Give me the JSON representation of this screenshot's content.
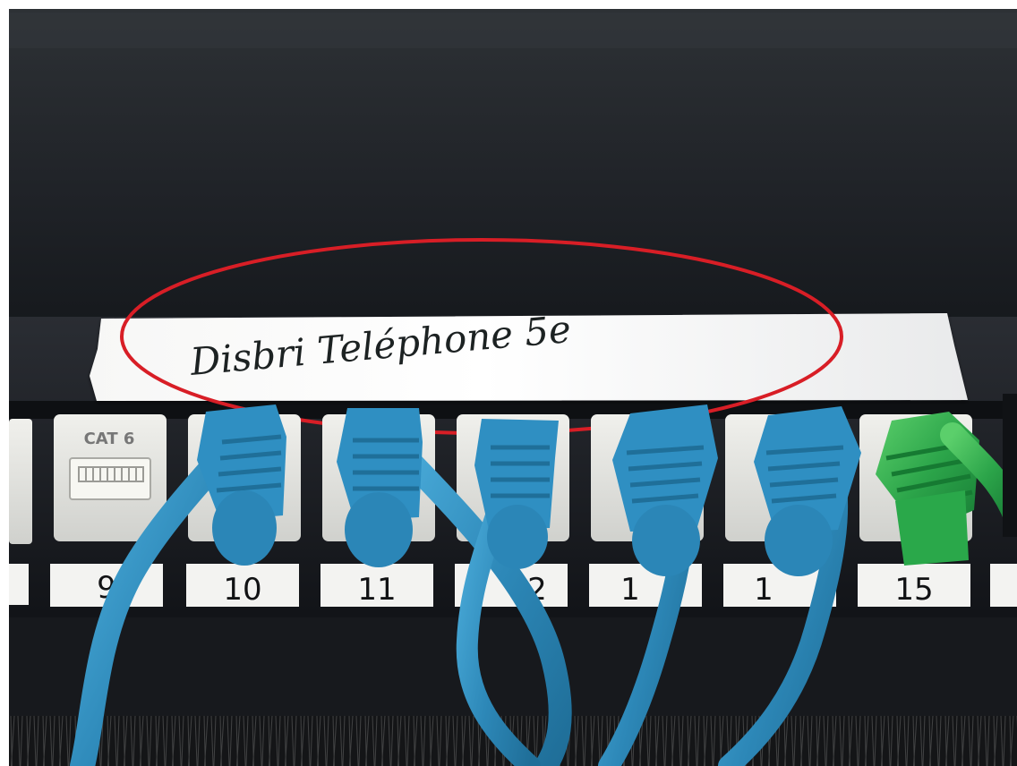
{
  "photo": {
    "subject": "Patch panel with handwritten label and connected RJ45 cables",
    "label_strip_text": "Disbri Teléphone 5e",
    "highlight_color": "#d81e26",
    "cable_color": "#2f8fc2",
    "green_cable_color": "#2aa84a",
    "jack_label": "CAT 6",
    "port_labels": [
      "9",
      "10",
      "11",
      "2",
      "1",
      "1",
      "15"
    ]
  }
}
